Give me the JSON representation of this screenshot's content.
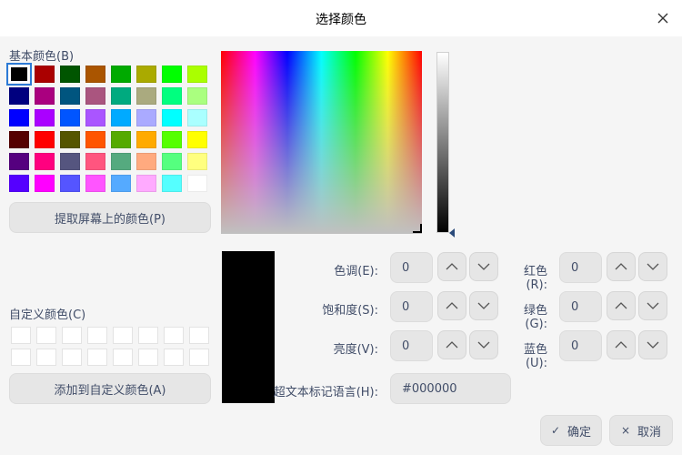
{
  "window": {
    "title": "选择颜色"
  },
  "basic_colors": {
    "label": "基本颜色(B)",
    "swatches": [
      "#000000",
      "#aa0000",
      "#005500",
      "#aa5500",
      "#00aa00",
      "#aaaa00",
      "#00ff00",
      "#aaff00",
      "#00007f",
      "#aa007f",
      "#00557f",
      "#aa557f",
      "#00aa7f",
      "#aaaa7f",
      "#00ff7f",
      "#aaff7f",
      "#0000ff",
      "#aa00ff",
      "#0055ff",
      "#aa55ff",
      "#00aaff",
      "#aaaaff",
      "#00ffff",
      "#aaffff",
      "#550000",
      "#ff0000",
      "#555500",
      "#ff5500",
      "#55aa00",
      "#ffaa00",
      "#55ff00",
      "#ffff00",
      "#55007f",
      "#ff007f",
      "#55557f",
      "#ff557f",
      "#55aa7f",
      "#ffaa7f",
      "#55ff7f",
      "#ffff7f",
      "#5500ff",
      "#ff00ff",
      "#5555ff",
      "#ff55ff",
      "#55aaff",
      "#ffaaff",
      "#55ffff",
      "#ffffff"
    ],
    "selected_index": 0
  },
  "pick_screen_label": "提取屏幕上的颜色(P)",
  "custom_colors": {
    "label": "自定义颜色(C)",
    "count": 16
  },
  "add_custom_label": "添加到自定义颜色(A)",
  "fields": {
    "hue": {
      "label": "色调(E):",
      "value": "0"
    },
    "sat": {
      "label": "饱和度(S):",
      "value": "0"
    },
    "val": {
      "label": "亮度(V):",
      "value": "0"
    },
    "red": {
      "label": "红色(R):",
      "value": "0"
    },
    "green": {
      "label": "绿色(G):",
      "value": "0"
    },
    "blue": {
      "label": "蓝色(U):",
      "value": "0"
    },
    "html": {
      "label": "超文本标记语言(H):",
      "value": "#000000"
    }
  },
  "buttons": {
    "ok": "确定",
    "ok_icon": "✓",
    "cancel": "取消",
    "cancel_icon": "×"
  },
  "current_color": "#000000",
  "icons": {
    "close": "close-icon",
    "up": "chevron-up-icon",
    "down": "chevron-down-icon"
  }
}
